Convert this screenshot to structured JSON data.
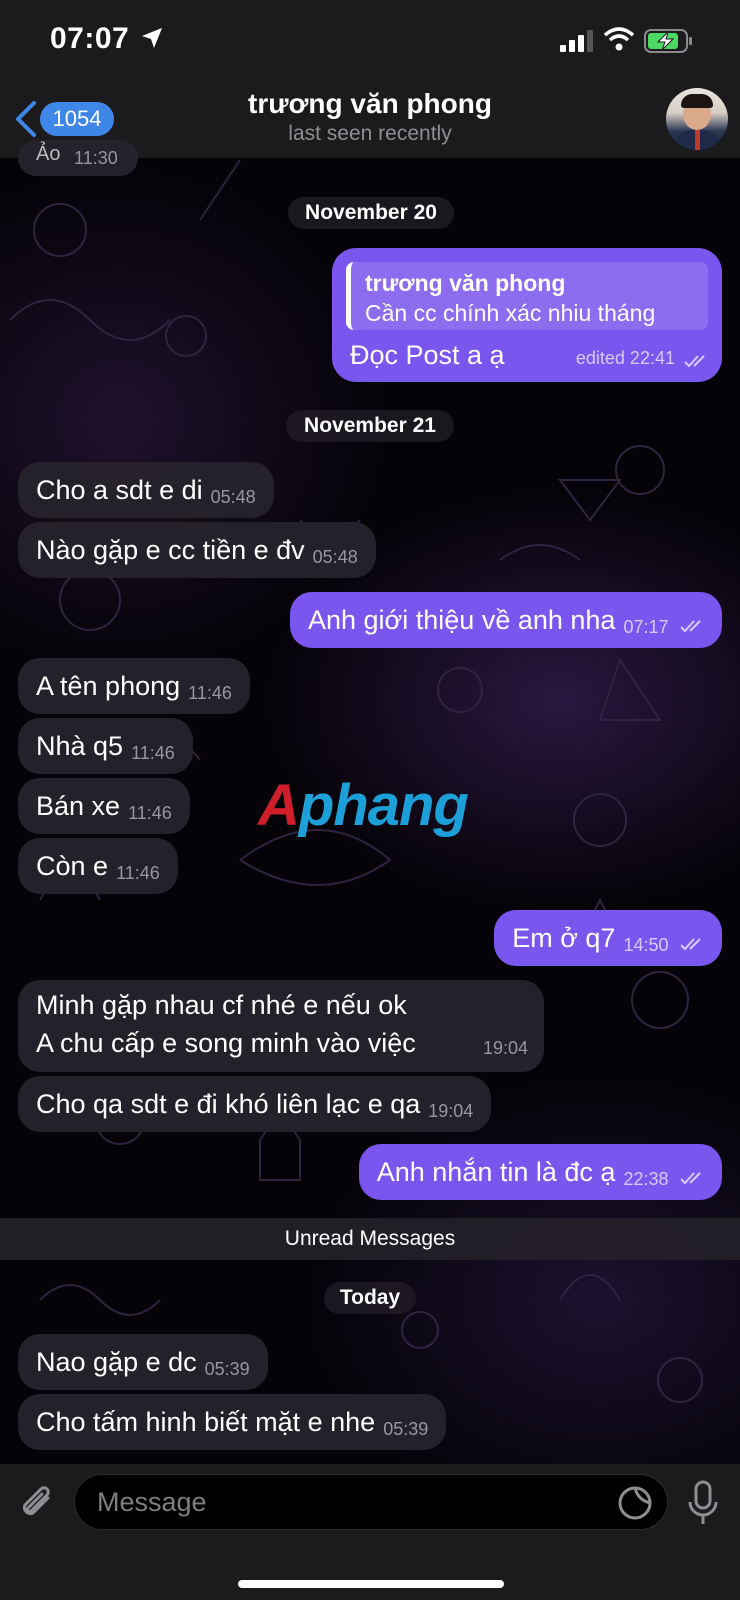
{
  "status_bar": {
    "time": "07:07",
    "icons": [
      "location-arrow-icon",
      "signal-icon",
      "wifi-icon",
      "battery-charging-icon"
    ]
  },
  "header": {
    "back_count": "1054",
    "contact_name": "trương văn phong",
    "status": "last seen recently"
  },
  "messages": {
    "partial_top": {
      "text": "Ảo",
      "time": "11:30"
    },
    "date_nov20": "November 20",
    "reply": {
      "quoted_name": "trương văn phong",
      "quoted_text": "Cần cc chính xác nhiu tháng",
      "text": "Đọc Post a ạ",
      "time": "edited 22:41"
    },
    "date_nov21": "November 21",
    "m1": {
      "text": "Cho a sdt e di",
      "time": "05:48"
    },
    "m2": {
      "text": "Nào gặp e cc tiền e đv",
      "time": "05:48"
    },
    "m3": {
      "text": "Anh giới thiệu về anh nha",
      "time": "07:17"
    },
    "m4": {
      "text": "A tên phong",
      "time": "11:46"
    },
    "m5": {
      "text": "Nhà q5",
      "time": "11:46"
    },
    "m6": {
      "text": "Bán xe",
      "time": "11:46"
    },
    "m7": {
      "text": "Còn e",
      "time": "11:46"
    },
    "m8": {
      "text": "Em ở q7",
      "time": "14:50"
    },
    "m9": {
      "line1": "Minh gặp nhau cf nhé e nếu ok",
      "line2": "A chu cấp e song minh vào việc",
      "time": "19:04"
    },
    "m10": {
      "text": "Cho qa sdt e đi khó liên lạc e qa",
      "time": "19:04"
    },
    "m11": {
      "text": "Anh nhắn tin là đc ạ",
      "time": "22:38"
    },
    "unread_label": "Unread Messages",
    "date_today": "Today",
    "m12": {
      "text": "Nao gặp e dc",
      "time": "05:39"
    },
    "m13": {
      "text": "Cho tấm hinh biết mặt e nhe",
      "time": "05:39"
    }
  },
  "watermark": {
    "first": "A",
    "rest": "phang"
  },
  "composer": {
    "placeholder": "Message"
  },
  "colors": {
    "outgoing": "#7a55ee",
    "incoming": "#26222c",
    "accent": "#3e86e8"
  }
}
